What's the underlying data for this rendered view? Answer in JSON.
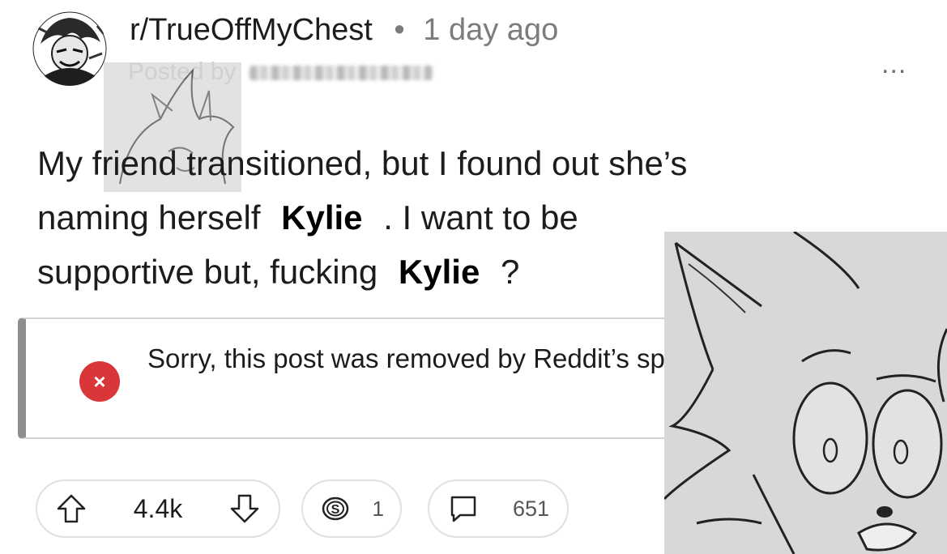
{
  "post": {
    "subreddit": "r/TrueOffMyChest",
    "separator": "•",
    "age": "1 day ago",
    "posted_by": "Posted by",
    "more_label": "...",
    "title_line1": "My friend transitioned, but I found out she’s",
    "title_line2_a": "naming herself",
    "title_line2_b": ". I want to be",
    "title_line3_a": "supportive but, fucking",
    "title_line3_b": "?",
    "name_overlay_1": "Kylie",
    "name_overlay_2": "Kylie"
  },
  "notice": {
    "icon_label": "×",
    "text": "Sorry, this post was removed by Reddit’s spam filters."
  },
  "actions": {
    "vote_count": "4.4k",
    "award_count": "1",
    "comment_count": "651"
  },
  "colors": {
    "notice_icon": "#d9363a",
    "notice_border": "#8e8e8e",
    "muted_text": "#7c7c7c",
    "sketch_background": "#d8d8d8"
  },
  "icons": {
    "upvote": "up-arrow-icon",
    "downvote": "down-arrow-icon",
    "award": "award-coin-icon",
    "comments": "comment-bubble-icon",
    "close": "close-icon"
  }
}
